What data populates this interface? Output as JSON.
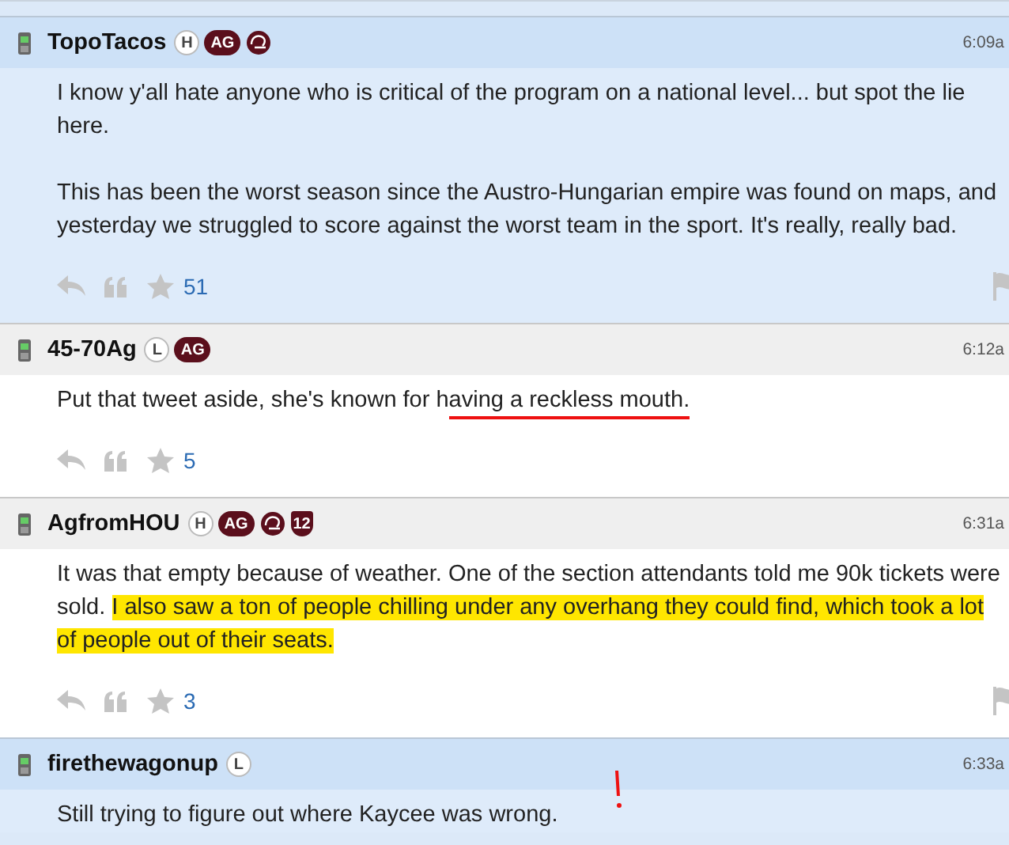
{
  "posts": [
    {
      "author": "TopoTacos",
      "time": "6:09a",
      "unread": true,
      "flag": true,
      "exclaim": false,
      "badges": [
        {
          "kind": "circle",
          "text": "H"
        },
        {
          "kind": "pill",
          "text": "AG"
        },
        {
          "kind": "helmet"
        }
      ],
      "paragraphs": [
        [
          {
            "text": "I know y'all hate anyone who is critical of the program on a national level... but spot the lie here.",
            "underlined": false,
            "highlighted": false
          }
        ],
        [
          {
            "text": "This has been the worst season since the Austro-Hungarian empire was found on maps, and yesterday we struggled to score against the worst team in the sport. It's really, really bad.",
            "underlined": false,
            "highlighted": false
          }
        ]
      ],
      "stars": "51"
    },
    {
      "author": "45-70Ag",
      "time": "6:12a",
      "unread": false,
      "flag": false,
      "exclaim": false,
      "badges": [
        {
          "kind": "circle",
          "text": "L"
        },
        {
          "kind": "pill",
          "text": "AG"
        }
      ],
      "paragraphs": [
        [
          {
            "text": "Put that tweet aside, she's known for h",
            "underlined": false,
            "highlighted": false
          },
          {
            "text": "aving a reckless mouth.",
            "underlined": true,
            "highlighted": false
          }
        ]
      ],
      "stars": "5"
    },
    {
      "author": "AgfromHOU",
      "time": "6:31a",
      "unread": false,
      "flag": true,
      "exclaim": false,
      "badges": [
        {
          "kind": "circle",
          "text": "H"
        },
        {
          "kind": "pill",
          "text": "AG"
        },
        {
          "kind": "helmet"
        },
        {
          "kind": "shield",
          "text": "12"
        }
      ],
      "paragraphs": [
        [
          {
            "text": "It was that empty because of weather. One of the section attendants told me 90k tickets were sold. ",
            "underlined": false,
            "highlighted": false
          },
          {
            "text": "I also saw a ton of people chilling under any overhang they could find, which took a lot of people out of their seats.",
            "underlined": false,
            "highlighted": true
          }
        ]
      ],
      "stars": "3"
    },
    {
      "author": "firethewagonup",
      "time": "6:33a",
      "unread": true,
      "exclaim": true,
      "badges": [
        {
          "kind": "circle",
          "text": "L"
        }
      ],
      "paragraphs": [
        [
          {
            "text": "Still trying to figure out where Kaycee was wrong.",
            "underlined": false,
            "highlighted": false
          }
        ]
      ]
    }
  ]
}
